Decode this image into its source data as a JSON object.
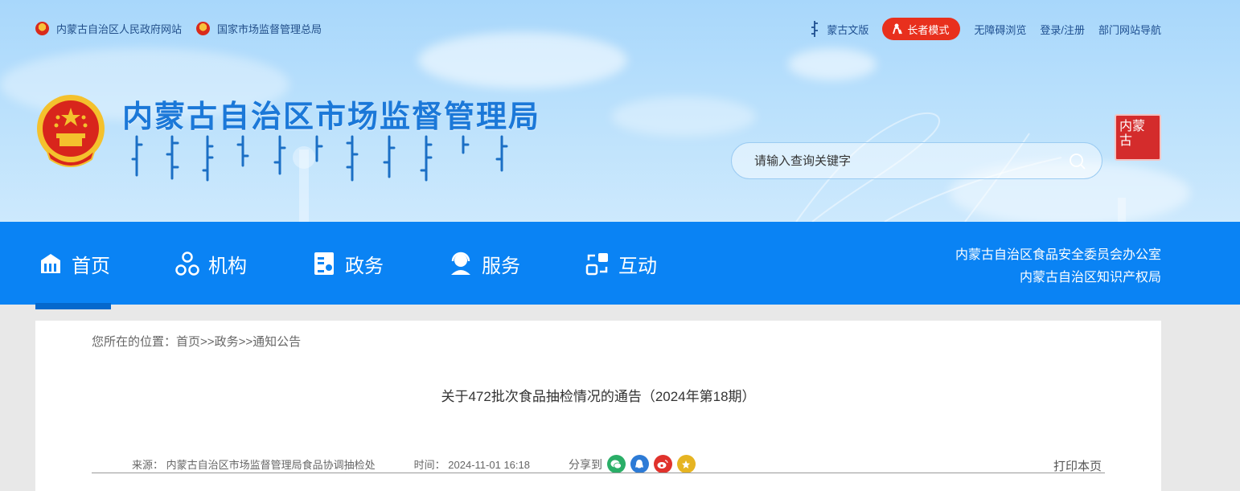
{
  "topbar": {
    "left_links": [
      "内蒙古自治区人民政府网站",
      "国家市场监督管理总局"
    ],
    "mongol_link": "蒙古文版",
    "elder_mode": "长者模式",
    "accessible": "无障碍浏览",
    "login": "登录/注册",
    "dept_nav": "部门网站导航"
  },
  "header": {
    "title": "内蒙古自治区市场监督管理局",
    "search_placeholder": "请输入查询关键字",
    "seal_text": "内蒙古"
  },
  "nav": {
    "items": [
      "首页",
      "机构",
      "政务",
      "服务",
      "互动"
    ],
    "active": "首页",
    "right_links": [
      "内蒙古自治区食品安全委员会办公室",
      "内蒙古自治区知识产权局"
    ]
  },
  "content": {
    "breadcrumb_prefix": "您所在的位置：",
    "breadcrumb": [
      "首页",
      "政务",
      "通知公告"
    ],
    "breadcrumb_sep": ">>",
    "title": "关于472批次食品抽检情况的通告（2024年第18期）",
    "source_label": "来源：",
    "source": "内蒙古自治区市场监督管理局食品协调抽检处",
    "time_label": "时间：",
    "time": "2024-11-01 16:18",
    "share_label": "分享到",
    "print": "打印本页"
  },
  "colors": {
    "nav_blue": "#0a83f4",
    "title_blue": "#1b78d8",
    "elder_red": "#e8301d"
  }
}
